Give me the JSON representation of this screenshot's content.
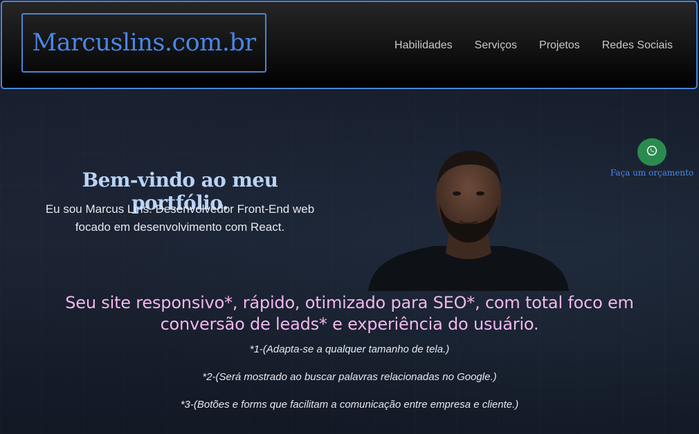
{
  "header": {
    "logo": "Marcuslins.com.br",
    "nav": [
      "Habilidades",
      "Serviços",
      "Projetos",
      "Redes Sociais"
    ]
  },
  "hero": {
    "title": "Bem-vindo ao meu portfólio.",
    "subtitle_line1": "Eu sou Marcus Lins. Desenvolvedor Front-End web",
    "subtitle_line2": "focado em desenvolvimento com React."
  },
  "whatsapp": {
    "label": "Faça um orçamento",
    "icon": "whatsapp-icon",
    "color": "#2a8b4f"
  },
  "pitch": {
    "headline_line1": "Seu site responsivo*, rápido, otimizado para SEO*, com total foco em",
    "headline_line2": "conversão de leads* e experiência do usuário.",
    "notes": [
      "*1-(Adapta-se a qualquer tamanho de tela.)",
      "*2-(Será mostrado ao buscar palavras relacionadas no Google.)",
      "*3-(Botões e forms que facilitam a comunicação entre empresa e cliente.)"
    ]
  },
  "colors": {
    "accent": "#4a86e8",
    "headline": "#f2b6ec",
    "hero_title": "#b9d3f5"
  }
}
